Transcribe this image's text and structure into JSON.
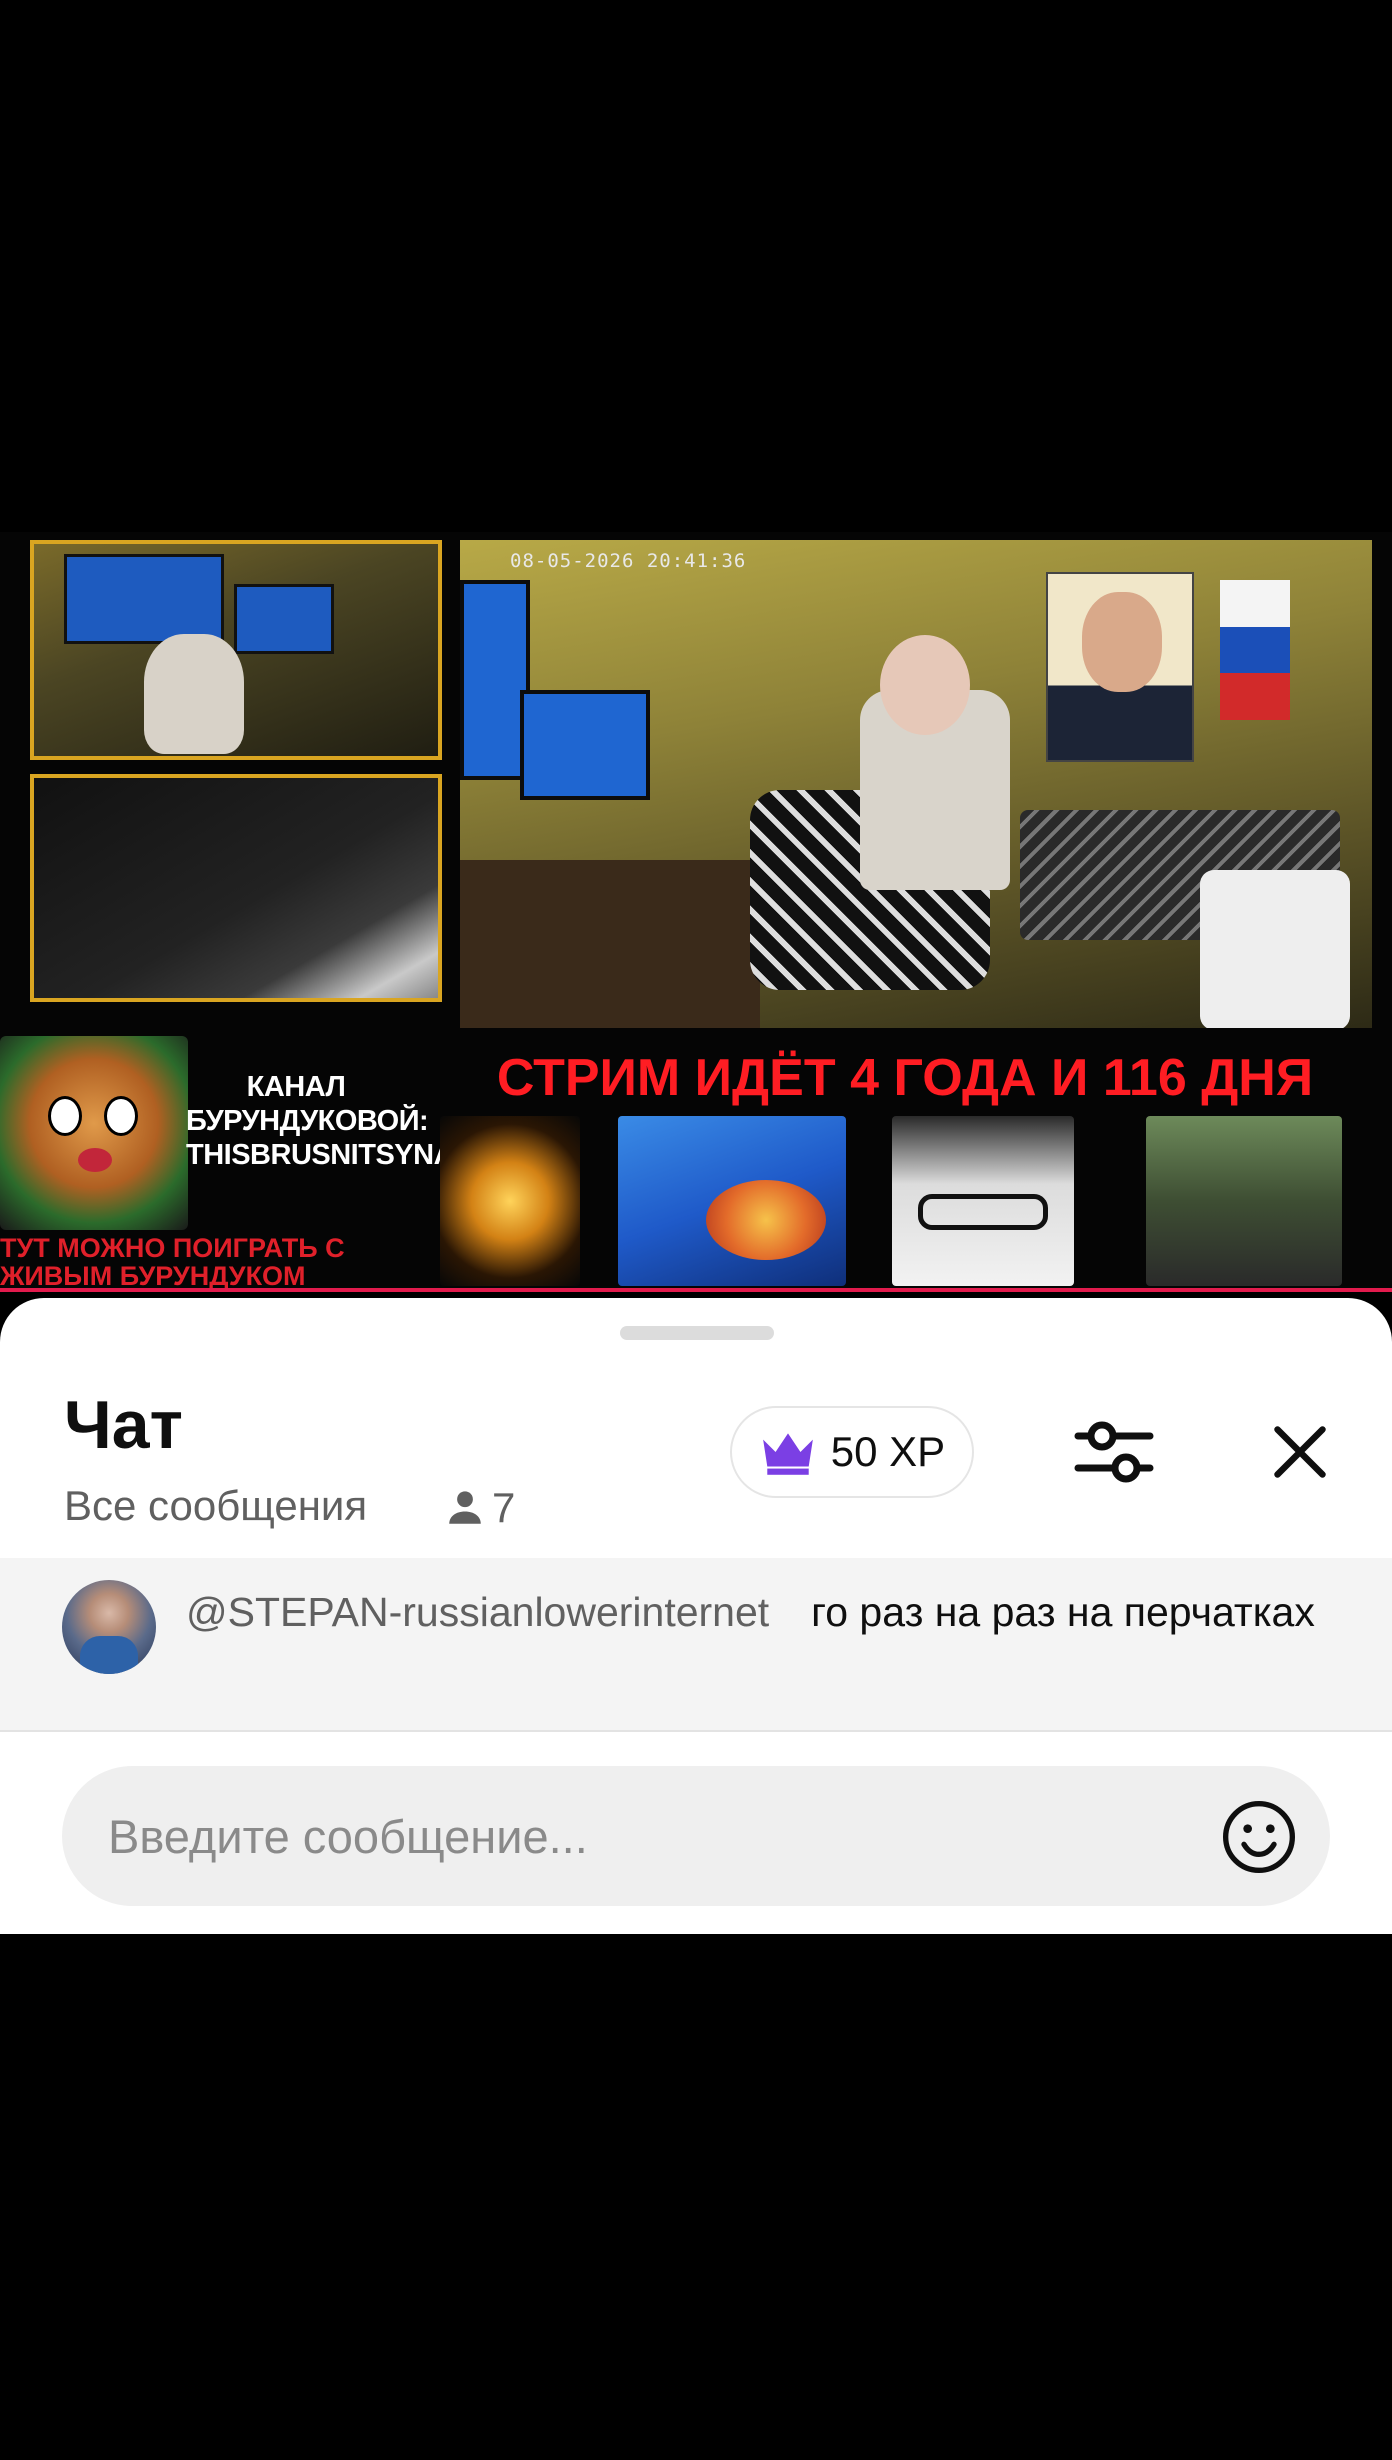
{
  "video": {
    "timestamp": "08-05-2026 20:41:36",
    "channel_text": "КАНАЛ БУРУНДУКОВОЙ: THISBRUSNITSYNA",
    "play_text": "ТУТ МОЖНО ПОИГРАТЬ С ЖИВЫМ БУРУНДУКОМ",
    "stream_title": "СТРИМ ИДЁТ 4 ГОДА И 116 ДНЯ"
  },
  "chat": {
    "title": "Чат",
    "filter_label": "Все сообщения",
    "viewer_count": "7",
    "xp_label": "50 XP",
    "messages": [
      {
        "author": "@STEPAN-russianlowerinternet",
        "text": "го раз на раз на перчатках"
      }
    ],
    "input_placeholder": "Введите сообщение..."
  },
  "icons": {
    "crown": "crown-icon",
    "person": "person-icon",
    "filter": "sliders-icon",
    "close": "close-icon",
    "emoji": "emoji-icon"
  },
  "colors": {
    "crown": "#7b3fe4",
    "title_red": "#ff1d23",
    "progress_line": "#e21b4d"
  }
}
